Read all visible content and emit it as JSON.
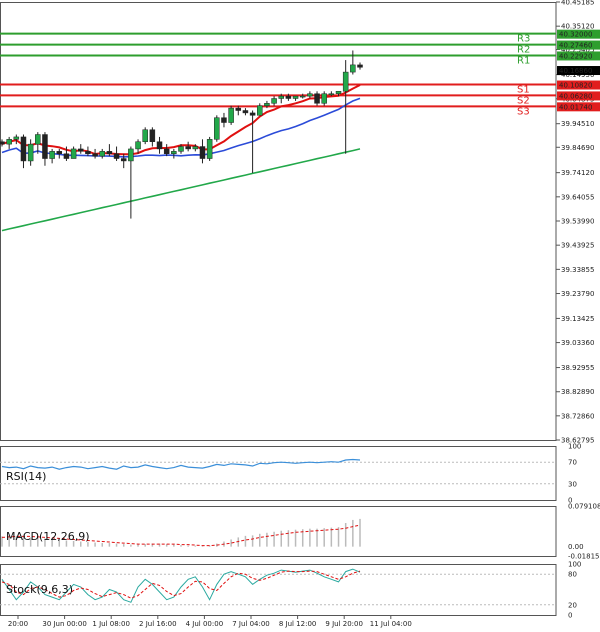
{
  "chart_data": [
    {
      "type": "candlestick",
      "ylim": [
        38.62795,
        40.45185
      ],
      "y_ticks": [
        "40.45185",
        "40.35120",
        "40.25405",
        "40.14950",
        "40.04875",
        "39.94510",
        "39.84690",
        "39.74120",
        "39.64055",
        "39.53990",
        "39.43925",
        "39.33855",
        "39.23790",
        "39.13425",
        "39.03360",
        "38.92955",
        "38.82890",
        "38.72860",
        "38.62795"
      ],
      "x_ticks": [
        "20:00",
        "30 Jun 00:00",
        "1 Jul 08:00",
        "2 Jul 16:00",
        "4 Jul 00:00",
        "7 Jul 04:00",
        "8 Jul 12:00",
        "9 Jul 20:00",
        "11 Jul 04:00"
      ],
      "current_price": "40.16860",
      "levels": [
        {
          "name": "R3",
          "value": 40.32,
          "label": "40.32000",
          "color": "#2e9e2e"
        },
        {
          "name": "R2",
          "value": 40.2746,
          "label": "40.27460",
          "color": "#2e9e2e"
        },
        {
          "name": "R1",
          "value": 40.2292,
          "label": "40.22920",
          "color": "#2e9e2e"
        },
        {
          "name": "S1",
          "value": 40.1082,
          "label": "40.10820",
          "color": "#e11d1d"
        },
        {
          "name": "S2",
          "value": 40.0628,
          "label": "40.06280",
          "color": "#e11d1d"
        },
        {
          "name": "S3",
          "value": 40.0174,
          "label": "40.01740",
          "color": "#e11d1d"
        }
      ],
      "candles": [
        [
          39.87,
          39.88,
          39.85,
          39.86
        ],
        [
          39.86,
          39.89,
          39.84,
          39.88
        ],
        [
          39.88,
          39.9,
          39.86,
          39.89
        ],
        [
          39.89,
          39.9,
          39.76,
          39.79
        ],
        [
          39.79,
          39.88,
          39.77,
          39.86
        ],
        [
          39.86,
          39.91,
          39.82,
          39.9
        ],
        [
          39.9,
          39.91,
          39.77,
          39.8
        ],
        [
          39.8,
          39.84,
          39.78,
          39.83
        ],
        [
          39.83,
          39.84,
          39.8,
          39.82
        ],
        [
          39.82,
          39.85,
          39.79,
          39.8
        ],
        [
          39.8,
          39.85,
          39.8,
          39.84
        ],
        [
          39.84,
          39.86,
          39.82,
          39.83
        ],
        [
          39.83,
          39.85,
          39.81,
          39.82
        ],
        [
          39.82,
          39.84,
          39.8,
          39.81
        ],
        [
          39.81,
          39.84,
          39.8,
          39.83
        ],
        [
          39.83,
          39.86,
          39.81,
          39.82
        ],
        [
          39.82,
          39.85,
          39.79,
          39.8
        ],
        [
          39.8,
          39.82,
          39.76,
          39.79
        ],
        [
          39.79,
          39.85,
          39.55,
          39.84
        ],
        [
          39.84,
          39.88,
          39.82,
          39.87
        ],
        [
          39.87,
          39.93,
          39.86,
          39.92
        ],
        [
          39.92,
          39.93,
          39.85,
          39.87
        ],
        [
          39.87,
          39.89,
          39.82,
          39.84
        ],
        [
          39.84,
          39.86,
          39.81,
          39.82
        ],
        [
          39.82,
          39.84,
          39.8,
          39.83
        ],
        [
          39.83,
          39.86,
          39.82,
          39.85
        ],
        [
          39.85,
          39.87,
          39.83,
          39.84
        ],
        [
          39.84,
          39.86,
          39.83,
          39.85
        ],
        [
          39.85,
          39.88,
          39.78,
          39.8
        ],
        [
          39.8,
          39.89,
          39.79,
          39.88
        ],
        [
          39.88,
          39.98,
          39.87,
          39.97
        ],
        [
          39.97,
          39.99,
          39.93,
          39.95
        ],
        [
          39.95,
          40.02,
          39.94,
          40.01
        ],
        [
          40.01,
          40.02,
          39.98,
          40.0
        ],
        [
          40.0,
          40.01,
          39.98,
          39.99
        ],
        [
          39.99,
          40.0,
          39.74,
          39.98
        ],
        [
          39.98,
          40.03,
          39.98,
          40.02
        ],
        [
          40.02,
          40.04,
          40.01,
          40.03
        ],
        [
          40.03,
          40.06,
          40.02,
          40.05
        ],
        [
          40.05,
          40.07,
          40.03,
          40.06
        ],
        [
          40.06,
          40.07,
          40.04,
          40.05
        ],
        [
          40.05,
          40.06,
          40.04,
          40.06
        ],
        [
          40.06,
          40.07,
          40.05,
          40.06
        ],
        [
          40.06,
          40.08,
          40.05,
          40.07
        ],
        [
          40.07,
          40.08,
          40.02,
          40.03
        ],
        [
          40.03,
          40.08,
          40.02,
          40.07
        ],
        [
          40.07,
          40.08,
          40.06,
          40.07
        ],
        [
          40.07,
          40.08,
          40.06,
          40.08
        ],
        [
          40.08,
          40.21,
          39.82,
          40.16
        ],
        [
          40.16,
          40.25,
          40.15,
          40.19
        ],
        [
          40.19,
          40.2,
          40.17,
          40.18
        ]
      ]
    },
    {
      "type": "line",
      "series_label": "RSI(14)",
      "ylim": [
        0,
        100
      ],
      "y_ticks": [
        "100",
        "70",
        "30",
        "0"
      ],
      "values": [
        62,
        60,
        61,
        58,
        63,
        60,
        59,
        61,
        57,
        60,
        62,
        61,
        58,
        60,
        62,
        59,
        57,
        63,
        60,
        61,
        65,
        62,
        60,
        58,
        60,
        64,
        61,
        60,
        59,
        62,
        66,
        64,
        67,
        66,
        65,
        63,
        68,
        67,
        69,
        70,
        69,
        68,
        69,
        70,
        69,
        70,
        71,
        70,
        74,
        75,
        74
      ]
    },
    {
      "type": "bar",
      "series_label": "MACD(12,26,9)",
      "ylim": [
        -0.018159,
        0.079108
      ],
      "y_ticks": [
        "0.079108",
        "0.00",
        "-0.018159"
      ],
      "values": [
        0.02,
        0.022,
        0.021,
        0.019,
        0.018,
        0.017,
        0.016,
        0.014,
        0.013,
        0.012,
        0.011,
        0.01,
        0.009,
        0.008,
        0.007,
        0.007,
        0.006,
        0.005,
        0.004,
        0.004,
        0.005,
        0.006,
        0.006,
        0.005,
        0.004,
        0.003,
        0.002,
        0.002,
        0.001,
        0.002,
        0.006,
        0.01,
        0.014,
        0.018,
        0.021,
        0.022,
        0.025,
        0.027,
        0.029,
        0.031,
        0.032,
        0.033,
        0.034,
        0.035,
        0.035,
        0.036,
        0.037,
        0.038,
        0.046,
        0.052,
        0.054
      ],
      "signal": [
        0.018,
        0.019,
        0.02,
        0.02,
        0.02,
        0.019,
        0.018,
        0.017,
        0.016,
        0.015,
        0.014,
        0.013,
        0.012,
        0.011,
        0.01,
        0.009,
        0.008,
        0.007,
        0.006,
        0.005,
        0.005,
        0.005,
        0.005,
        0.005,
        0.005,
        0.004,
        0.004,
        0.003,
        0.002,
        0.002,
        0.003,
        0.005,
        0.007,
        0.01,
        0.013,
        0.015,
        0.018,
        0.02,
        0.022,
        0.024,
        0.026,
        0.028,
        0.029,
        0.03,
        0.031,
        0.032,
        0.033,
        0.034,
        0.036,
        0.039,
        0.042
      ]
    },
    {
      "type": "line",
      "series_label": "Stock(9,6,3)",
      "ylim": [
        0,
        100
      ],
      "y_ticks": [
        "100",
        "80",
        "20",
        "0"
      ],
      "k": [
        70,
        50,
        30,
        45,
        65,
        55,
        40,
        35,
        30,
        45,
        60,
        55,
        40,
        30,
        35,
        50,
        45,
        30,
        25,
        55,
        70,
        60,
        45,
        30,
        35,
        55,
        70,
        75,
        55,
        30,
        60,
        80,
        85,
        80,
        75,
        60,
        70,
        78,
        82,
        88,
        86,
        84,
        86,
        88,
        82,
        75,
        70,
        65,
        85,
        90,
        84
      ],
      "d": [
        65,
        60,
        45,
        40,
        52,
        55,
        50,
        42,
        35,
        38,
        48,
        53,
        50,
        42,
        36,
        40,
        44,
        40,
        33,
        38,
        50,
        62,
        58,
        46,
        38,
        42,
        55,
        66,
        65,
        52,
        48,
        62,
        75,
        82,
        80,
        72,
        68,
        72,
        78,
        84,
        86,
        85,
        85,
        86,
        85,
        80,
        75,
        70,
        75,
        82,
        86
      ]
    }
  ]
}
